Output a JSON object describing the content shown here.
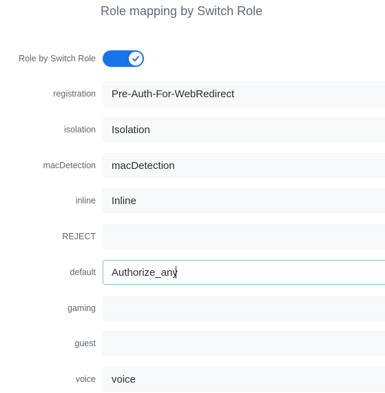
{
  "header": {
    "title": "Role mapping by Switch Role"
  },
  "toggle": {
    "label": "Role by Switch Role",
    "state": "on",
    "icon": "check-icon"
  },
  "fields": {
    "registration": {
      "label": "registration",
      "value": "Pre-Auth-For-WebRedirect"
    },
    "isolation": {
      "label": "isolation",
      "value": "Isolation"
    },
    "macDetection": {
      "label": "macDetection",
      "value": "macDetection"
    },
    "inline": {
      "label": "inline",
      "value": "Inline"
    },
    "reject": {
      "label": "REJECT",
      "value": ""
    },
    "default": {
      "label": "default",
      "value": "Authorize_any"
    },
    "gaming": {
      "label": "gaming",
      "value": ""
    },
    "guest": {
      "label": "guest",
      "value": ""
    },
    "voice": {
      "label": "voice",
      "value": "voice"
    }
  },
  "colors": {
    "accent": "#1a73e8",
    "focus_border": "#7dc8a6",
    "input_bg": "#f7f9fb"
  }
}
